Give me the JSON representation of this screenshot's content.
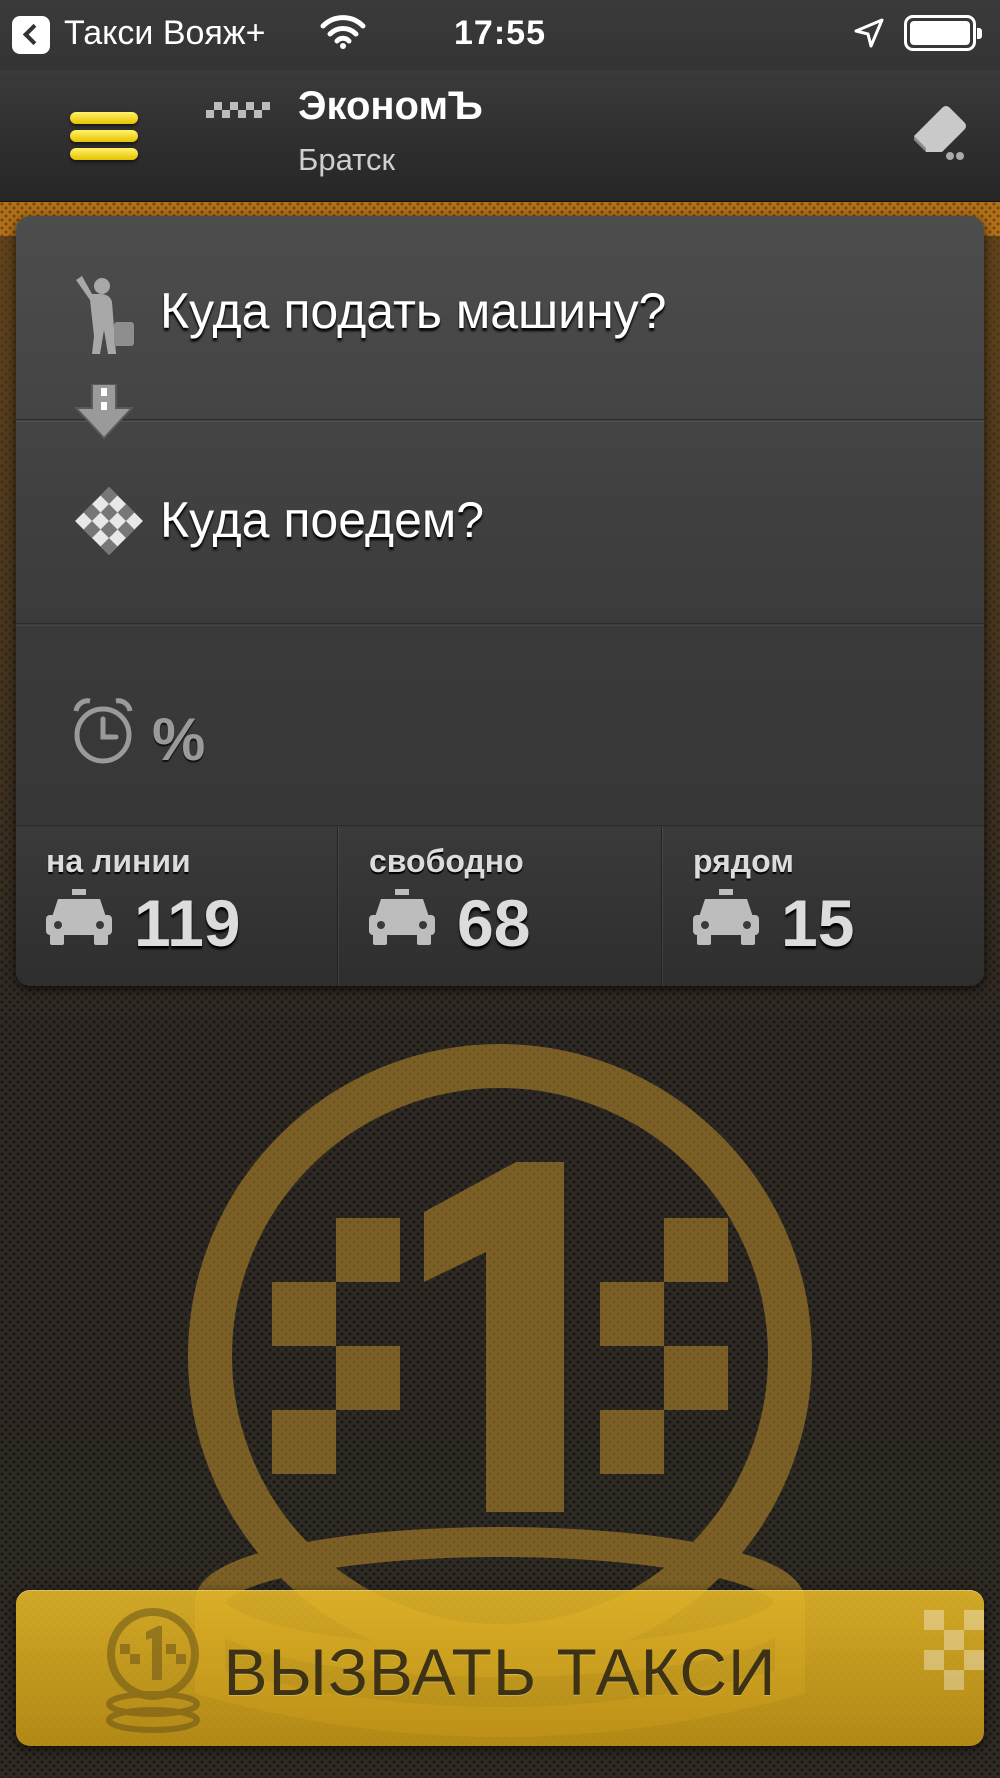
{
  "status_bar": {
    "back_label": "Такси Вояж+",
    "time": "17:55"
  },
  "nav": {
    "title": "ЭкономЪ",
    "subtitle": "Братск"
  },
  "order": {
    "pickup_placeholder": "Куда подать машину?",
    "destination_placeholder": "Куда поедем?",
    "discount_symbol": "%"
  },
  "stats": [
    {
      "label": "на линии",
      "value": "119"
    },
    {
      "label": "свободно",
      "value": "68"
    },
    {
      "label": "рядом",
      "value": "15"
    }
  ],
  "logo": {
    "digit": "1"
  },
  "call_button": {
    "label": "ВЫЗВАТЬ ТАКСИ"
  },
  "colors": {
    "accent_yellow": "#f2c81a",
    "brand_orange": "#b0701a",
    "panel_gray": "#3f3f3f"
  },
  "icons": {
    "menu": "hamburger-icon",
    "eraser": "eraser-icon",
    "pickup": "passenger-icon",
    "arrow": "arrow-down-icon",
    "destination": "finish-flag-icon",
    "time": "alarm-clock-icon",
    "car": "taxi-car-icon"
  }
}
